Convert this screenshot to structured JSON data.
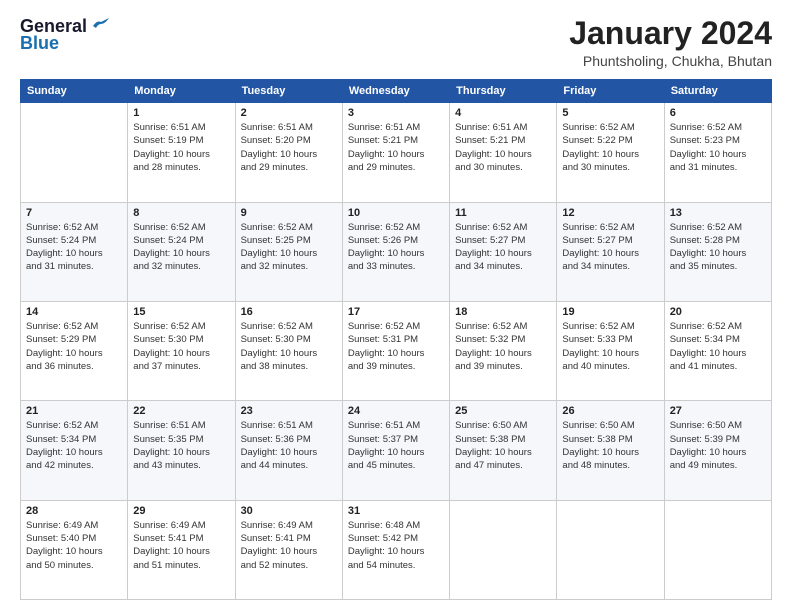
{
  "logo": {
    "line1": "General",
    "line2": "Blue"
  },
  "header": {
    "month": "January 2024",
    "location": "Phuntsholing, Chukha, Bhutan"
  },
  "weekdays": [
    "Sunday",
    "Monday",
    "Tuesday",
    "Wednesday",
    "Thursday",
    "Friday",
    "Saturday"
  ],
  "weeks": [
    [
      {
        "day": "",
        "info": ""
      },
      {
        "day": "1",
        "info": "Sunrise: 6:51 AM\nSunset: 5:19 PM\nDaylight: 10 hours\nand 28 minutes."
      },
      {
        "day": "2",
        "info": "Sunrise: 6:51 AM\nSunset: 5:20 PM\nDaylight: 10 hours\nand 29 minutes."
      },
      {
        "day": "3",
        "info": "Sunrise: 6:51 AM\nSunset: 5:21 PM\nDaylight: 10 hours\nand 29 minutes."
      },
      {
        "day": "4",
        "info": "Sunrise: 6:51 AM\nSunset: 5:21 PM\nDaylight: 10 hours\nand 30 minutes."
      },
      {
        "day": "5",
        "info": "Sunrise: 6:52 AM\nSunset: 5:22 PM\nDaylight: 10 hours\nand 30 minutes."
      },
      {
        "day": "6",
        "info": "Sunrise: 6:52 AM\nSunset: 5:23 PM\nDaylight: 10 hours\nand 31 minutes."
      }
    ],
    [
      {
        "day": "7",
        "info": "Sunrise: 6:52 AM\nSunset: 5:24 PM\nDaylight: 10 hours\nand 31 minutes."
      },
      {
        "day": "8",
        "info": "Sunrise: 6:52 AM\nSunset: 5:24 PM\nDaylight: 10 hours\nand 32 minutes."
      },
      {
        "day": "9",
        "info": "Sunrise: 6:52 AM\nSunset: 5:25 PM\nDaylight: 10 hours\nand 32 minutes."
      },
      {
        "day": "10",
        "info": "Sunrise: 6:52 AM\nSunset: 5:26 PM\nDaylight: 10 hours\nand 33 minutes."
      },
      {
        "day": "11",
        "info": "Sunrise: 6:52 AM\nSunset: 5:27 PM\nDaylight: 10 hours\nand 34 minutes."
      },
      {
        "day": "12",
        "info": "Sunrise: 6:52 AM\nSunset: 5:27 PM\nDaylight: 10 hours\nand 34 minutes."
      },
      {
        "day": "13",
        "info": "Sunrise: 6:52 AM\nSunset: 5:28 PM\nDaylight: 10 hours\nand 35 minutes."
      }
    ],
    [
      {
        "day": "14",
        "info": "Sunrise: 6:52 AM\nSunset: 5:29 PM\nDaylight: 10 hours\nand 36 minutes."
      },
      {
        "day": "15",
        "info": "Sunrise: 6:52 AM\nSunset: 5:30 PM\nDaylight: 10 hours\nand 37 minutes."
      },
      {
        "day": "16",
        "info": "Sunrise: 6:52 AM\nSunset: 5:30 PM\nDaylight: 10 hours\nand 38 minutes."
      },
      {
        "day": "17",
        "info": "Sunrise: 6:52 AM\nSunset: 5:31 PM\nDaylight: 10 hours\nand 39 minutes."
      },
      {
        "day": "18",
        "info": "Sunrise: 6:52 AM\nSunset: 5:32 PM\nDaylight: 10 hours\nand 39 minutes."
      },
      {
        "day": "19",
        "info": "Sunrise: 6:52 AM\nSunset: 5:33 PM\nDaylight: 10 hours\nand 40 minutes."
      },
      {
        "day": "20",
        "info": "Sunrise: 6:52 AM\nSunset: 5:34 PM\nDaylight: 10 hours\nand 41 minutes."
      }
    ],
    [
      {
        "day": "21",
        "info": "Sunrise: 6:52 AM\nSunset: 5:34 PM\nDaylight: 10 hours\nand 42 minutes."
      },
      {
        "day": "22",
        "info": "Sunrise: 6:51 AM\nSunset: 5:35 PM\nDaylight: 10 hours\nand 43 minutes."
      },
      {
        "day": "23",
        "info": "Sunrise: 6:51 AM\nSunset: 5:36 PM\nDaylight: 10 hours\nand 44 minutes."
      },
      {
        "day": "24",
        "info": "Sunrise: 6:51 AM\nSunset: 5:37 PM\nDaylight: 10 hours\nand 45 minutes."
      },
      {
        "day": "25",
        "info": "Sunrise: 6:50 AM\nSunset: 5:38 PM\nDaylight: 10 hours\nand 47 minutes."
      },
      {
        "day": "26",
        "info": "Sunrise: 6:50 AM\nSunset: 5:38 PM\nDaylight: 10 hours\nand 48 minutes."
      },
      {
        "day": "27",
        "info": "Sunrise: 6:50 AM\nSunset: 5:39 PM\nDaylight: 10 hours\nand 49 minutes."
      }
    ],
    [
      {
        "day": "28",
        "info": "Sunrise: 6:49 AM\nSunset: 5:40 PM\nDaylight: 10 hours\nand 50 minutes."
      },
      {
        "day": "29",
        "info": "Sunrise: 6:49 AM\nSunset: 5:41 PM\nDaylight: 10 hours\nand 51 minutes."
      },
      {
        "day": "30",
        "info": "Sunrise: 6:49 AM\nSunset: 5:41 PM\nDaylight: 10 hours\nand 52 minutes."
      },
      {
        "day": "31",
        "info": "Sunrise: 6:48 AM\nSunset: 5:42 PM\nDaylight: 10 hours\nand 54 minutes."
      },
      {
        "day": "",
        "info": ""
      },
      {
        "day": "",
        "info": ""
      },
      {
        "day": "",
        "info": ""
      }
    ]
  ]
}
